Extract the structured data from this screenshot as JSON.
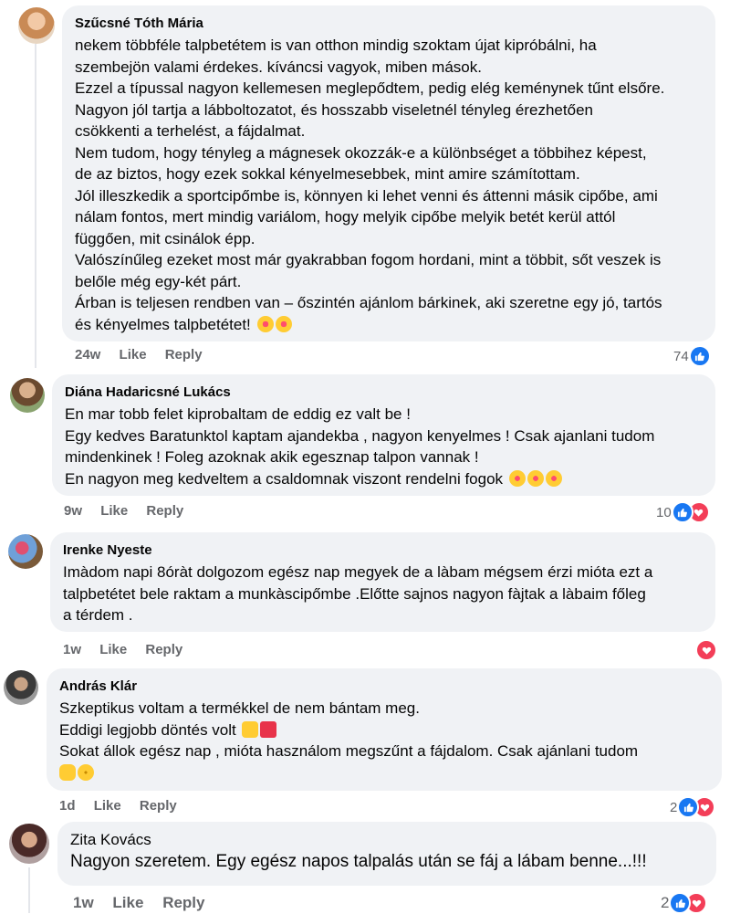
{
  "comments": [
    {
      "author": "Szűcsné Tóth Mária",
      "lines": [
        "nekem többféle talpbetétem is van otthon mindig szoktam újat kipróbálni, ha",
        "szembejön valami érdekes. kíváncsi vagyok, miben mások.",
        "Ezzel a típussal nagyon kellemesen meglepődtem, pedig elég keménynek tűnt elsőre.",
        "Nagyon jól tartja a lábboltozatot, és hosszabb viseletnél tényleg érezhetően",
        "csökkenti a terhelést, a fájdalmat.",
        "Nem tudom, hogy tényleg a mágnesek okozzák-e a különbséget a többihez képest,",
        "de az biztos, hogy ezek sokkal kényelmesebbek, mint amire számítottam.",
        "Jól illeszkedik a sportcipőmbe is, könnyen ki lehet venni és áttenni másik cipőbe, ami",
        "nálam fontos, mert mindig variálom, hogy melyik cipőbe melyik betét kerül attól",
        "függően, mit csinálok épp.",
        "Valószínűleg ezeket most már gyakrabban fogom hordani, mint a többit, sőt veszek is",
        "belőle még egy-két párt.",
        "Árban is teljesen rendben van – őszintén ajánlom bárkinek, aki szeretne egy jó, tartós",
        "és kényelmes talpbetétet!"
      ],
      "time": "24w",
      "like": "Like",
      "reply": "Reply",
      "count": "74"
    },
    {
      "author": "Diána Hadaricsné Lukács",
      "lines": [
        "En mar tobb felet kiprobaltam de eddig ez valt be !",
        "Egy kedves Baratunktol kaptam ajandekba , nagyon kenyelmes ! Csak ajanlani tudom",
        "mindenkinek ! Foleg azoknak akik egesznap talpon vannak !",
        "En nagyon meg kedveltem a csaldomnak viszont rendelni fogok"
      ],
      "time": "9w",
      "like": "Like",
      "reply": "Reply",
      "count": "10"
    },
    {
      "author": "Irenke Nyeste",
      "lines": [
        "Imàdom napi 8óràt dolgozom egész nap megyek de a làbam mégsem érzi mióta ezt a",
        "talpbetétet bele raktam a munkàscipőmbe .Előtte sajnos nagyon fàjtak a làbaim főleg",
        "a térdem ."
      ],
      "time": "1w",
      "like": "Like",
      "reply": "Reply",
      "count": ""
    },
    {
      "author": "András Klár",
      "lines": [
        "Szkeptikus voltam a termékkel de nem bántam meg.",
        "Eddigi legjobb döntés volt",
        "Sokat állok egész nap , mióta használom megszűnt a fájdalom. Csak ajánlani tudom",
        ""
      ],
      "time": "1d",
      "like": "Like",
      "reply": "Reply",
      "count": "2"
    },
    {
      "author": "Zita Kovács",
      "lines": [
        "Nagyon szeretem. Egy egész napos talpalás után se fáj a lábam benne...!!!"
      ],
      "time": "1w",
      "like": "Like",
      "reply": "Reply",
      "count": "2"
    }
  ]
}
